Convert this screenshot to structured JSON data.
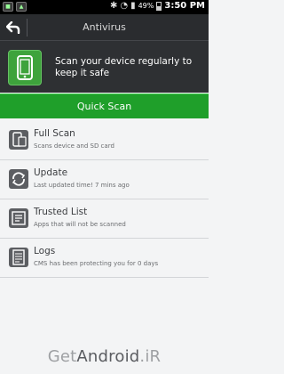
{
  "status_bar": {
    "battery_percent": "49%",
    "time": "3:50 PM",
    "left_icons": [
      "chat-icon",
      "notification-icon"
    ],
    "right_icons": [
      "bluetooth-icon",
      "wifi-icon",
      "signal-icon",
      "battery-icon"
    ]
  },
  "title_bar": {
    "title": "Antivirus",
    "back_icon": "back-arrow-icon"
  },
  "header": {
    "icon": "phone-icon",
    "message": "Scan your device regularly to keep it safe"
  },
  "quick_scan": {
    "label": "Quick Scan"
  },
  "menu": [
    {
      "title": "Full Scan",
      "subtitle": "Scans device and SD card",
      "icon": "device-scan-icon"
    },
    {
      "title": "Update",
      "subtitle": "Last updated time! 7 mins ago",
      "icon": "refresh-icon"
    },
    {
      "title": "Trusted List",
      "subtitle": "Apps that will not be scanned",
      "icon": "checklist-icon"
    },
    {
      "title": "Logs",
      "subtitle": "CMS has been protecting you for 0 days",
      "icon": "document-icon"
    }
  ],
  "watermark": {
    "prefix": "Get",
    "bold": "Android",
    "suffix": ".iR"
  },
  "colors": {
    "accent_green": "#1f9f2a",
    "header_bg": "#2e3033",
    "list_bg": "#f3f4f5"
  }
}
